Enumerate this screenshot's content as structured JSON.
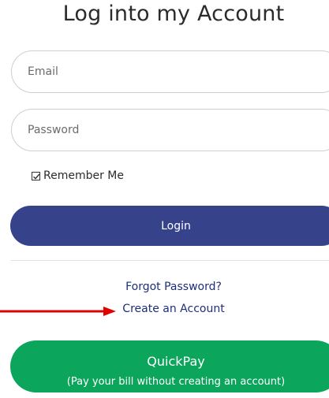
{
  "page": {
    "title": "Log into my Account"
  },
  "form": {
    "email": {
      "placeholder": "Email",
      "value": ""
    },
    "password": {
      "placeholder": "Password",
      "value": ""
    },
    "remember_me": {
      "label": "Remember Me",
      "checked": true
    },
    "login_label": "Login"
  },
  "links": {
    "forgot_password": "Forgot Password?",
    "create_account": "Create an Account"
  },
  "quickpay": {
    "label": "QuickPay",
    "subtitle": "(Pay your bill without creating an account)"
  },
  "colors": {
    "login_button": "#36428a",
    "quickpay_button": "#0ba55c",
    "link": "#1e2f7a",
    "arrow": "#e00000"
  },
  "icons": {
    "checkbox": "checkmark-icon",
    "annotation": "red-arrow-icon"
  }
}
